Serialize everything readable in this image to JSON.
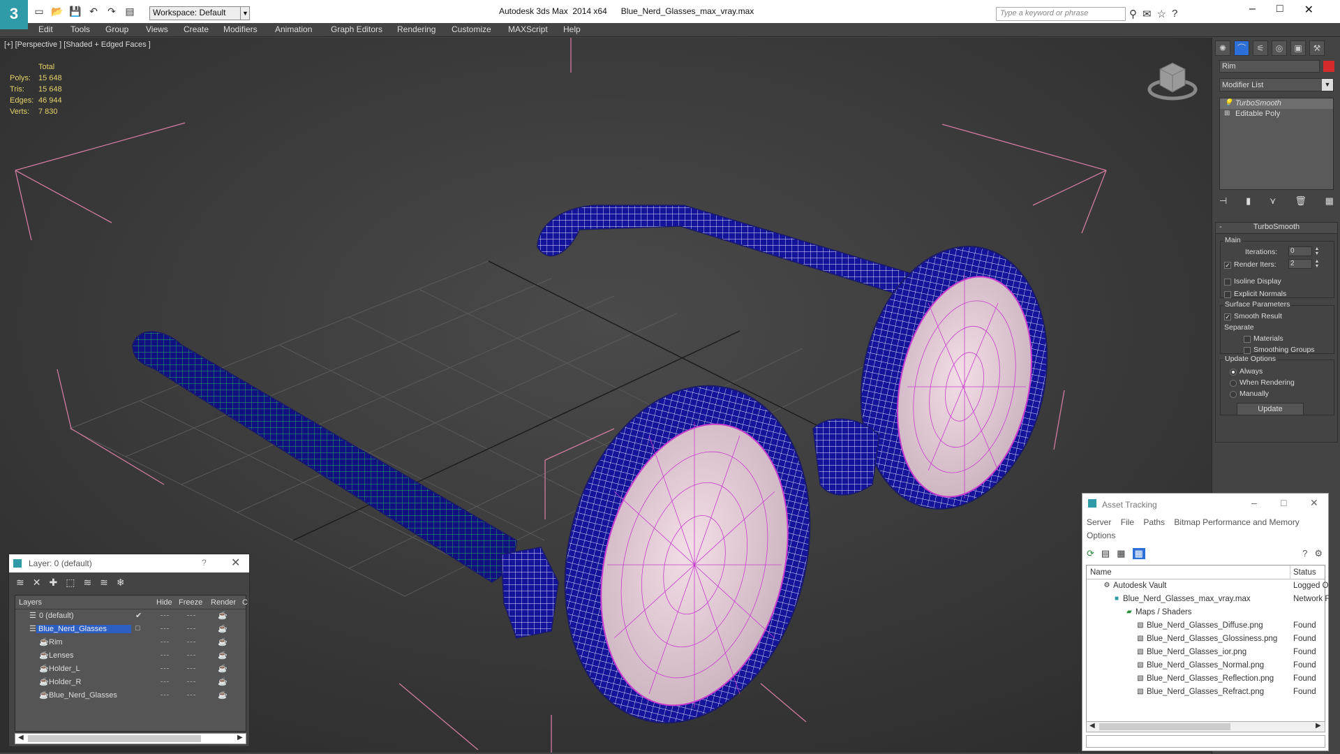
{
  "app": {
    "title": "Autodesk 3ds Max  2014 x64      Blue_Nerd_Glasses_max_vray.max",
    "logo_letter": "3",
    "workspace": "Workspace: Default",
    "search_placeholder": "Type a keyword or phrase",
    "window_controls": [
      "–",
      "□",
      "✕"
    ]
  },
  "menu": [
    "Edit",
    "Tools",
    "Group",
    "Views",
    "Create",
    "Modifiers",
    "Animation",
    "Graph Editors",
    "Rendering",
    "Customize",
    "MAXScript",
    "Help"
  ],
  "viewport": {
    "label": "[+] [Perspective ] [Shaded + Edged Faces ]",
    "stats": {
      "header": "Total",
      "rows": [
        {
          "k": "Polys:",
          "v": "15 648"
        },
        {
          "k": "Tris:",
          "v": "15 648"
        },
        {
          "k": "Edges:",
          "v": "46 944"
        },
        {
          "k": "Verts:",
          "v": "7 830"
        }
      ]
    }
  },
  "command_panel": {
    "object_name": "Rim",
    "object_color": "#d42a2a",
    "modifier_list": "Modifier List",
    "stack": [
      {
        "label": "TurboSmooth",
        "selected": true
      },
      {
        "label": "Editable Poly",
        "selected": false
      }
    ],
    "rollout": {
      "title": "TurboSmooth",
      "main_label": "Main",
      "iterations_label": "Iterations:",
      "iterations_value": "0",
      "render_iters_label": "Render Iters:",
      "render_iters_value": "2",
      "isoline_label": "Isoline Display",
      "explicit_label": "Explicit Normals",
      "surface_label": "Surface Parameters",
      "smooth_label": "Smooth Result",
      "separate_label": "Separate",
      "materials_label": "Materials",
      "smoothing_label": "Smoothing Groups",
      "update_options_label": "Update Options",
      "always_label": "Always",
      "when_rendering_label": "When Rendering",
      "manually_label": "Manually",
      "update_button": "Update"
    }
  },
  "layer_panel": {
    "title": "Layer: 0 (default)",
    "help": "?",
    "columns": {
      "layers": "Layers",
      "hide": "Hide",
      "freeze": "Freeze",
      "render": "Render",
      "c": "C"
    },
    "rows": [
      {
        "name": "0 (default)",
        "indent": 0,
        "selected": false,
        "check": "✔"
      },
      {
        "name": "Blue_Nerd_Glasses",
        "indent": 0,
        "selected": true,
        "check": ""
      },
      {
        "name": "Rim",
        "indent": 1,
        "selected": false,
        "check": ""
      },
      {
        "name": "Lenses",
        "indent": 1,
        "selected": false,
        "check": ""
      },
      {
        "name": "Holder_L",
        "indent": 1,
        "selected": false,
        "check": ""
      },
      {
        "name": "Holder_R",
        "indent": 1,
        "selected": false,
        "check": ""
      },
      {
        "name": "Blue_Nerd_Glasses",
        "indent": 1,
        "selected": false,
        "check": ""
      }
    ]
  },
  "asset_tracking": {
    "title": "Asset Tracking",
    "menu": [
      "Server",
      "File",
      "Paths",
      "Bitmap Performance and Memory",
      "Options"
    ],
    "columns": {
      "name": "Name",
      "status": "Status"
    },
    "rows": [
      {
        "name": "Autodesk Vault",
        "status": "Logged O",
        "indent": 1
      },
      {
        "name": "Blue_Nerd_Glasses_max_vray.max",
        "status": "Network F",
        "indent": 2
      },
      {
        "name": "Maps / Shaders",
        "status": "",
        "indent": 3
      },
      {
        "name": "Blue_Nerd_Glasses_Diffuse.png",
        "status": "Found",
        "indent": 4
      },
      {
        "name": "Blue_Nerd_Glasses_Glossiness.png",
        "status": "Found",
        "indent": 4
      },
      {
        "name": "Blue_Nerd_Glasses_ior.png",
        "status": "Found",
        "indent": 4
      },
      {
        "name": "Blue_Nerd_Glasses_Normal.png",
        "status": "Found",
        "indent": 4
      },
      {
        "name": "Blue_Nerd_Glasses_Reflection.png",
        "status": "Found",
        "indent": 4
      },
      {
        "name": "Blue_Nerd_Glasses_Refract.png",
        "status": "Found",
        "indent": 4
      }
    ]
  }
}
